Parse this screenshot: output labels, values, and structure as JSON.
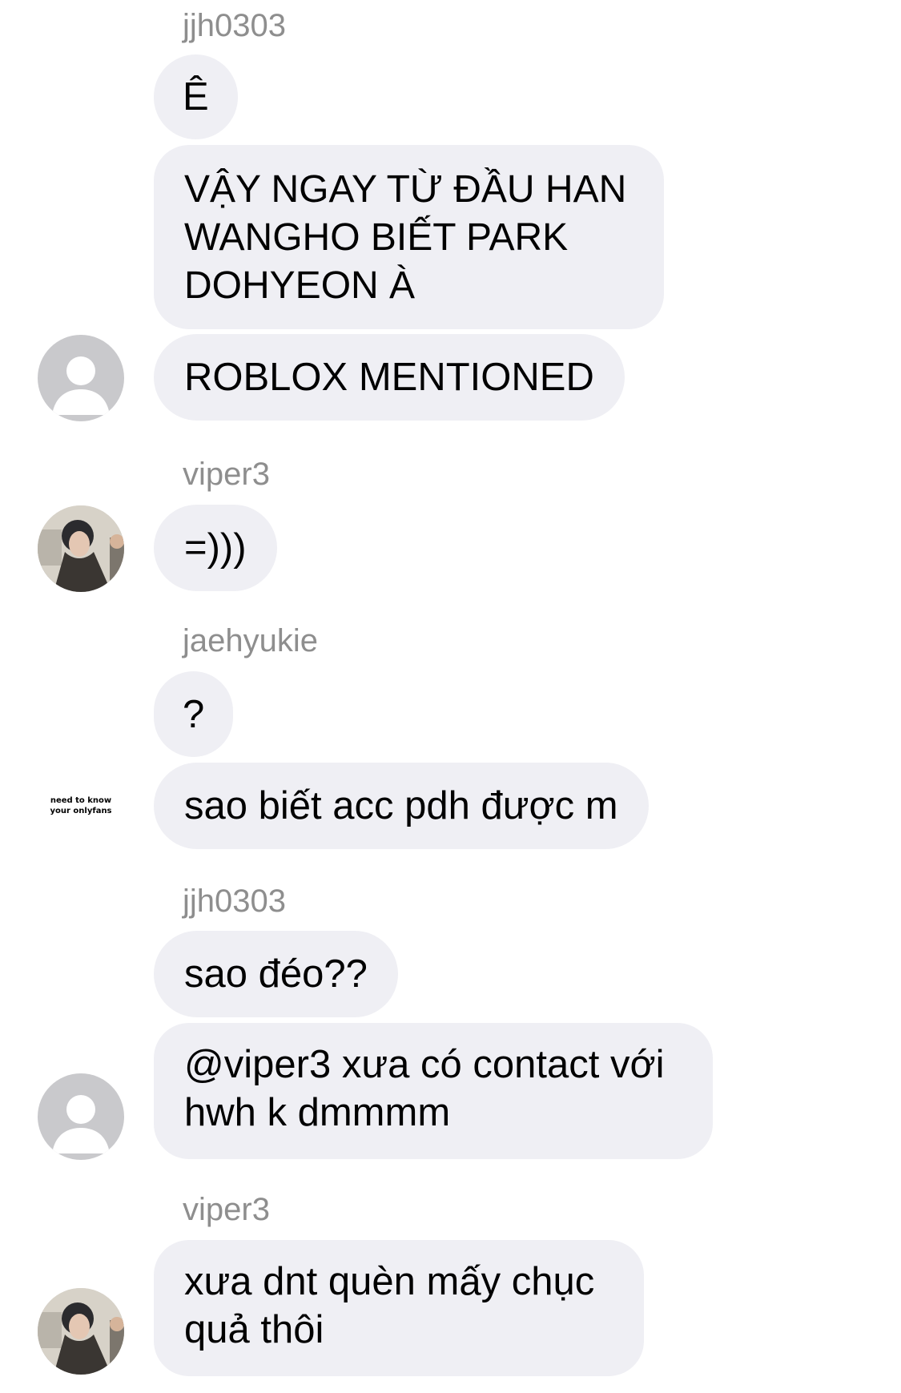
{
  "chat": {
    "groups": [
      {
        "username": "jjh0303",
        "messages": [
          "Ê",
          "VẬY NGAY TỪ ĐẦU HAN WANGHO BIẾT PARK DOHYEON À",
          "ROBLOX MENTIONED"
        ],
        "avatar": "default-person-avatar"
      },
      {
        "username": "viper3",
        "messages": [
          "=)))"
        ],
        "avatar": "profile-photo-avatar"
      },
      {
        "username": "jaehyukie",
        "messages": [
          "?",
          "sao biết acc pdh được m"
        ],
        "avatar": "text-avatar",
        "avatar_text": [
          "need to know",
          "your onlyfans"
        ]
      },
      {
        "username": "jjh0303",
        "messages": [
          "sao đéo??",
          "@viper3 xưa có contact với hwh k dmmmm"
        ],
        "avatar": "default-person-avatar"
      },
      {
        "username": "viper3",
        "messages": [
          "xưa dnt quèn mấy chục quả thôi"
        ],
        "avatar": "profile-photo-avatar"
      }
    ]
  },
  "colors": {
    "bubble_background": "#efeff4",
    "username_text": "#8e8e8e",
    "default_avatar": "#c9c9cc"
  }
}
